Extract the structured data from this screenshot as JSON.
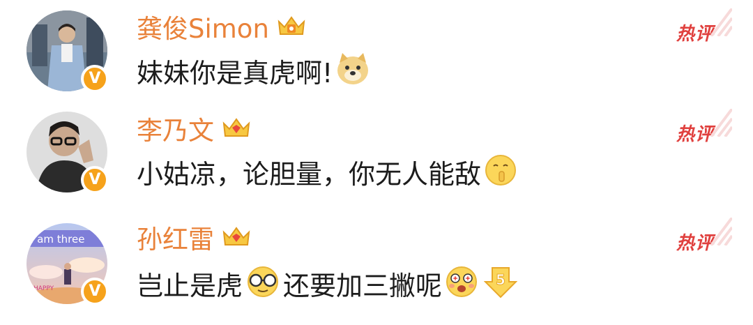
{
  "comments": [
    {
      "username": "龚俊Simon",
      "text_parts": [
        "妹妹你是真虎啊!"
      ],
      "hot_label": "热评",
      "verified_badge": "V"
    },
    {
      "username": "李乃文",
      "text_parts": [
        "小姑凉，论胆量，你无人能敌"
      ],
      "hot_label": "热评",
      "verified_badge": "V"
    },
    {
      "username": "孙红雷",
      "text_parts": [
        "岂止是虎",
        "还要加三撇呢"
      ],
      "hot_label": "热评",
      "verified_badge": "V"
    }
  ],
  "avatar3_banner_text": "I am three",
  "avatar3_small_text": "HAPPY",
  "colors": {
    "username": "#e9823a",
    "text": "#1c1c1c",
    "hot": "#e0403e",
    "verified": "#f6a21b"
  },
  "icons": {
    "crown": "crown-badge-icon",
    "doge": "doge-emoji-icon",
    "shush": "shush-face-emoji-icon",
    "glasses": "glasses-face-emoji-icon",
    "amazed": "amazed-face-emoji-icon",
    "five": "number-five-arrow-icon"
  }
}
